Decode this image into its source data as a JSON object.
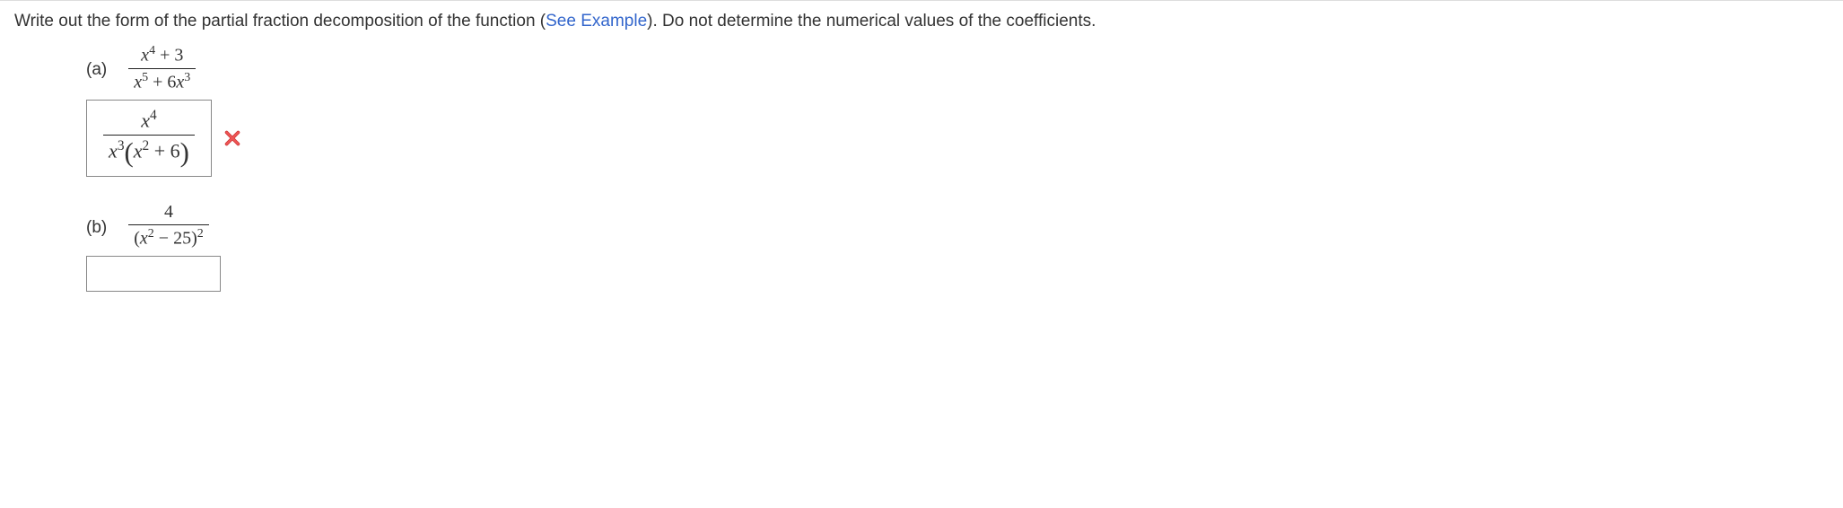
{
  "instruction": {
    "prefix": "Write out the form of the partial fraction decomposition of the function (",
    "link": "See Example",
    "suffix": "). Do not determine the numerical values of the coefficients."
  },
  "problems": {
    "a": {
      "label": "(a)",
      "numerator_html": "x<sup>4</sup> + 3",
      "denominator_html": "x<sup>5</sup> + 6x<sup>3</sup>",
      "answer": {
        "numerator_html": "x<sup>4</sup>",
        "denominator_html": "x<sup>3</sup>(x<sup>2</sup> + 6)"
      },
      "status": "incorrect"
    },
    "b": {
      "label": "(b)",
      "numerator_html": "4",
      "denominator_html": "(x<sup>2</sup> − 25)<sup>2</sup>",
      "answer": {
        "value": ""
      },
      "status": "empty"
    }
  }
}
